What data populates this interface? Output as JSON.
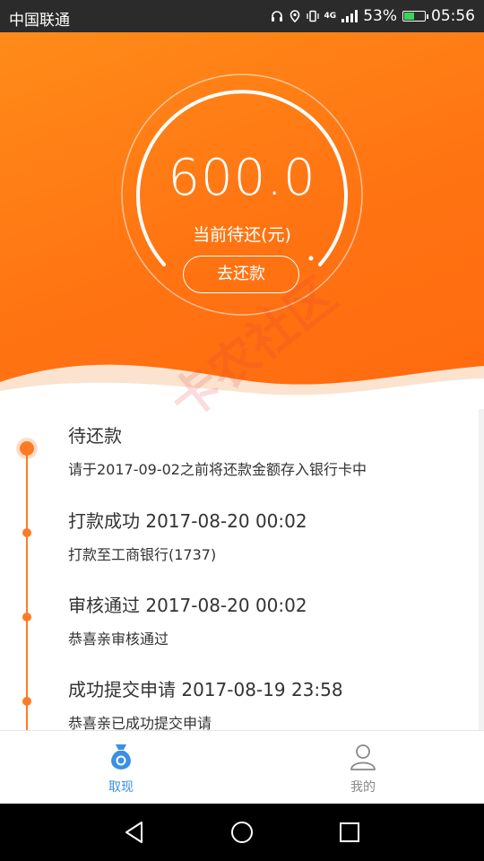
{
  "status_bar": {
    "carrier": "中国联通",
    "battery_text": "53%",
    "battery_level": 0.53,
    "time": "05:56",
    "network_label": "4G"
  },
  "hero": {
    "amount": "600.0",
    "amount_label": "当前待还(元)",
    "repay_button": "去还款",
    "watermark": "卡农社区",
    "colors": {
      "gradient_start": "#ff8b19",
      "gradient_end": "#ff6a10"
    }
  },
  "timeline": {
    "accent_color": "#ff7a25",
    "items": [
      {
        "title": "待还款",
        "desc": "请于2017-09-02之前将还款金额存入银行卡中"
      },
      {
        "title": "打款成功 2017-08-20 00:02",
        "desc": "打款至工商银行(1737)"
      },
      {
        "title": "审核通过 2017-08-20 00:02",
        "desc": "恭喜亲审核通过"
      },
      {
        "title": "成功提交申请 2017-08-19 23:58",
        "desc": "恭喜亲已成功提交申请"
      }
    ]
  },
  "bottom_nav": {
    "tabs": [
      {
        "label": "取现",
        "icon": "money-bag-icon",
        "active": true,
        "color": "#3b8fe5"
      },
      {
        "label": "我的",
        "icon": "user-icon",
        "active": false,
        "color": "#888888"
      }
    ]
  },
  "system_nav": {
    "buttons": [
      "back-icon",
      "home-icon",
      "recents-icon"
    ]
  }
}
